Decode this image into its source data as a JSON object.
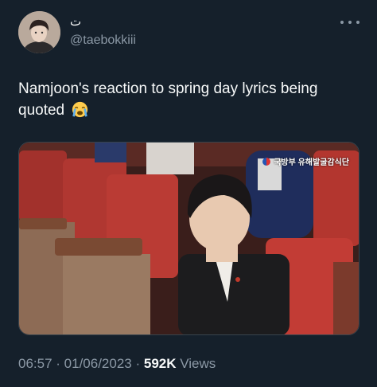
{
  "header": {
    "display_name": "ت",
    "handle": "@taebokkiii",
    "more_icon": "more-dots-icon",
    "avatar_icon": "profile-avatar"
  },
  "tweet": {
    "text": "Namjoon's reaction to spring day lyrics being quoted",
    "emoji": "loudly-crying-face-emoji"
  },
  "media": {
    "overlay_text": "국방부 유해발굴감식단",
    "description_icon": "video-still-image"
  },
  "meta": {
    "time": "06:57",
    "sep1": " · ",
    "date": "01/06/2023",
    "sep2": " · ",
    "views_count": "592K",
    "views_label": " Views"
  },
  "colors": {
    "background": "#15202b",
    "primary_text": "#f7f9f9",
    "secondary_text": "#8b98a5"
  }
}
